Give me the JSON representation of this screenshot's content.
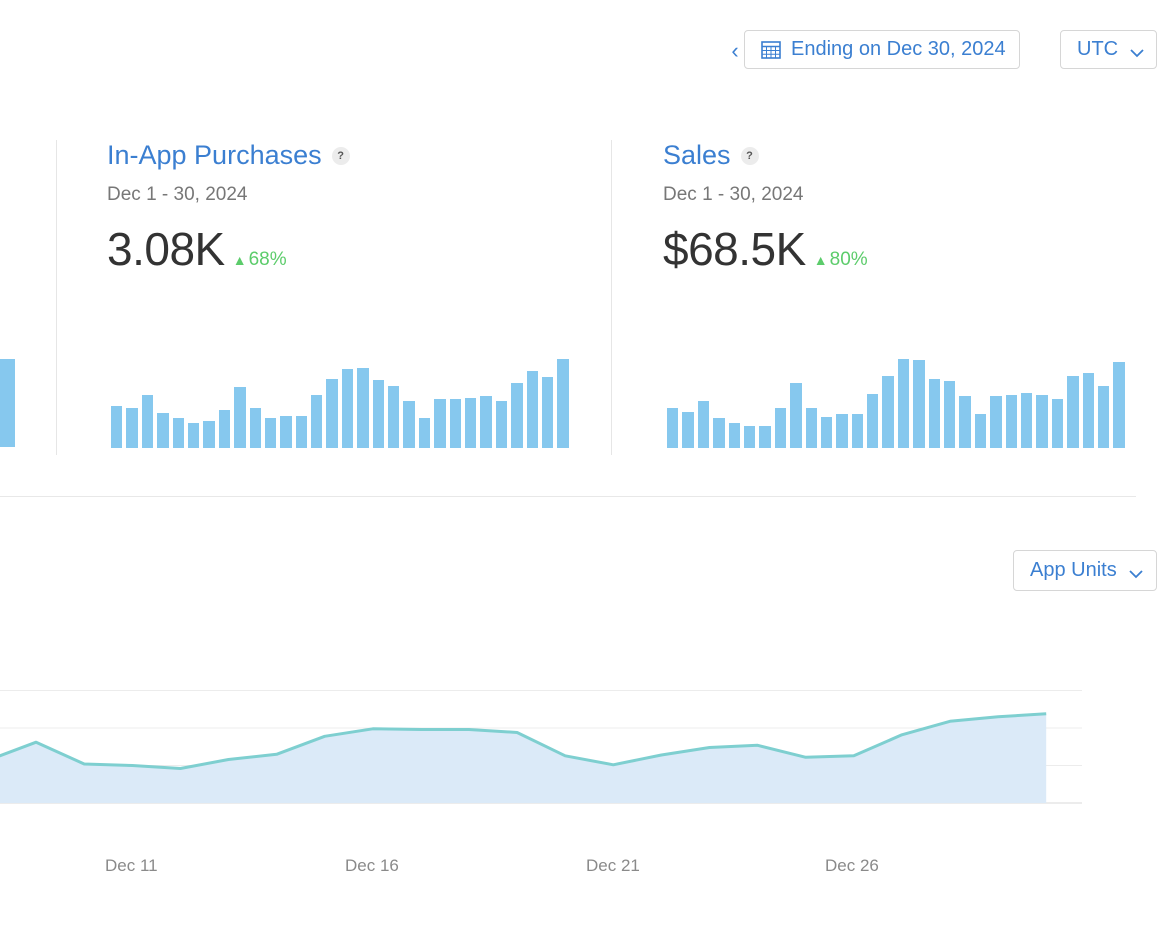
{
  "header": {
    "prev_label": "‹",
    "date_range_label": "Ending on Dec 30, 2024",
    "timezone_label": "UTC"
  },
  "panels": [
    {
      "title": "In-App Purchases",
      "help": "?",
      "subtitle": "Dec 1 - 30, 2024",
      "value": "3.08K",
      "delta": "68%",
      "bars": [
        0.47,
        0.45,
        0.59,
        0.39,
        0.34,
        0.28,
        0.3,
        0.43,
        0.68,
        0.45,
        0.34,
        0.36,
        0.36,
        0.59,
        0.78,
        0.89,
        0.9,
        0.76,
        0.7,
        0.53,
        0.34,
        0.55,
        0.55,
        0.56,
        0.58,
        0.53,
        0.73,
        0.87,
        0.8,
        1.0
      ]
    },
    {
      "title": "Sales",
      "help": "?",
      "subtitle": "Dec 1 - 30, 2024",
      "value": "$68.5K",
      "delta": "80%",
      "bars": [
        0.45,
        0.4,
        0.53,
        0.34,
        0.28,
        0.25,
        0.25,
        0.45,
        0.73,
        0.45,
        0.35,
        0.38,
        0.38,
        0.61,
        0.81,
        1.0,
        0.99,
        0.78,
        0.75,
        0.58,
        0.38,
        0.58,
        0.6,
        0.62,
        0.6,
        0.55,
        0.81,
        0.84,
        0.7,
        0.97
      ]
    }
  ],
  "left_panel_partial_bar": 1.0,
  "metric_selector": {
    "label": "App Units"
  },
  "chart_data": {
    "type": "area",
    "x": [
      "Dec 8",
      "Dec 9",
      "Dec 10",
      "Dec 11",
      "Dec 12",
      "Dec 13",
      "Dec 14",
      "Dec 15",
      "Dec 16",
      "Dec 17",
      "Dec 18",
      "Dec 19",
      "Dec 20",
      "Dec 21",
      "Dec 22",
      "Dec 23",
      "Dec 24",
      "Dec 25",
      "Dec 26",
      "Dec 27",
      "Dec 28",
      "Dec 29",
      "Dec 30"
    ],
    "y": [
      0.57,
      0.81,
      0.52,
      0.5,
      0.46,
      0.58,
      0.65,
      0.89,
      0.99,
      0.98,
      0.98,
      0.94,
      0.63,
      0.51,
      0.64,
      0.74,
      0.77,
      0.61,
      0.63,
      0.91,
      1.09,
      1.15,
      1.19
    ],
    "ylim": [
      0,
      1.5
    ],
    "xtick_labels": [
      "Dec 11",
      "Dec 16",
      "Dec 21",
      "Dec 26"
    ],
    "grid": true,
    "line_color": "#7ecfd0",
    "fill_color": "#dbeaf8"
  },
  "colors": {
    "accent": "#3b7fd1",
    "positive": "#5ccc6b",
    "bar": "#86c8ee"
  }
}
